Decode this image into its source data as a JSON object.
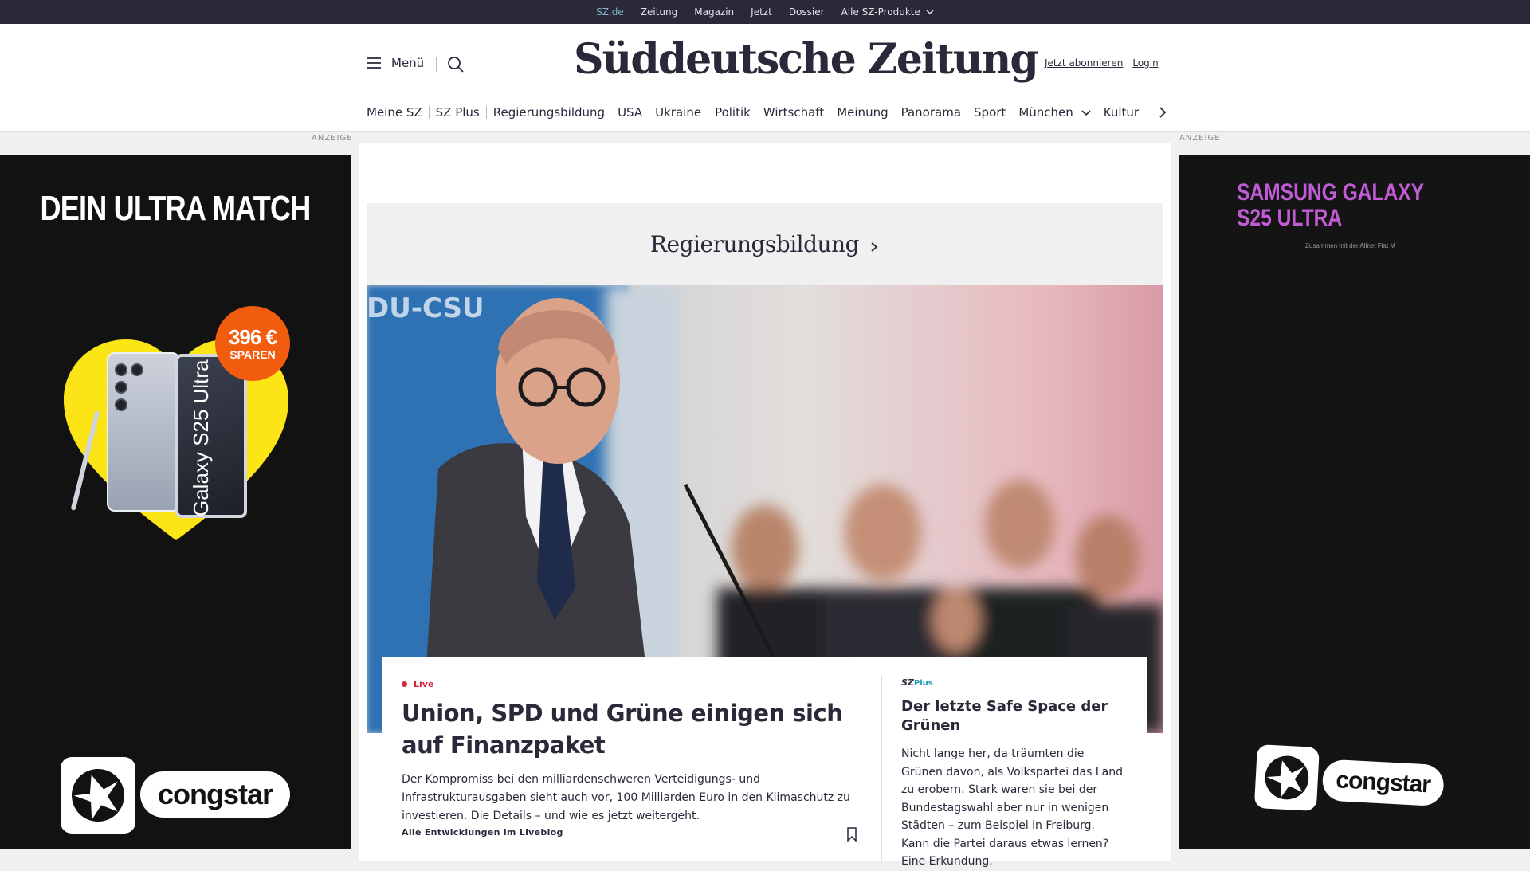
{
  "topbar": {
    "items": [
      {
        "label": "SZ.de",
        "active": true
      },
      {
        "label": "Zeitung"
      },
      {
        "label": "Magazin"
      },
      {
        "label": "Jetzt"
      },
      {
        "label": "Dossier"
      },
      {
        "label": "Alle SZ-Produkte",
        "has_dropdown": true
      }
    ]
  },
  "header": {
    "menu_label": "Menü",
    "search_icon": "search-icon",
    "logo_text": "Süddeutsche Zeitung",
    "subscribe_label": "Jetzt abonnieren",
    "login_label": "Login"
  },
  "nav": {
    "items": [
      {
        "label": "Meine SZ"
      },
      {
        "label": "SZ Plus"
      },
      {
        "label": "Regierungsbildung"
      },
      {
        "label": "USA"
      },
      {
        "label": "Ukraine"
      },
      {
        "label": "Politik"
      },
      {
        "label": "Wirtschaft"
      },
      {
        "label": "Meinung"
      },
      {
        "label": "Panorama"
      },
      {
        "label": "Sport"
      },
      {
        "label": "München",
        "has_dropdown": true
      },
      {
        "label": "Kultur"
      }
    ],
    "next_icon": "chevron-right-icon"
  },
  "ads": {
    "label": "ANZEIGE",
    "left": {
      "headline": "DEIN ULTRA MATCH",
      "badge_value": "396 €",
      "badge_text": "SPAREN",
      "phone_text": "Galaxy S25 Ultra",
      "brand": "congstar"
    },
    "right": {
      "headline_line1": "SAMSUNG GALAXY",
      "headline_line2": "S25 ULTRA",
      "small_text": "Zusammen mit der Allnet Flat M",
      "brand": "congstar"
    }
  },
  "teaser": {
    "section_title": "Regierungsbildung"
  },
  "lead_story": {
    "live_label": "Live",
    "headline": "Union, SPD und Grüne einigen sich auf Finanzpaket",
    "teaser": "Der Kompromiss bei den milliardenschweren Verteidigungs- und Infrastrukturausgaben sieht auch vor, 100 Milliarden Euro in den Klimaschutz zu investieren. Die Details – und wie es jetzt weitergeht.",
    "liveblog_link": "Alle Entwicklungen im Liveblog",
    "hero_sign_text": "DU-CSU"
  },
  "side_story": {
    "brand_sz": "SZ",
    "brand_plus": "Plus",
    "headline": "Der letzte Safe Space der Grünen",
    "teaser": "Nicht lange her, da träumten die Grünen davon, als Volkspartei das Land zu erobern. Stark waren sie bei der Bundestagswahl aber nur in wenigen Städten – zum Beispiel in Freiburg. Kann die Partei daraus etwas lernen? Eine Erkundung."
  },
  "colors": {
    "topbar_bg": "#29293a",
    "text": "#29293a",
    "live_red": "#d7263d",
    "plus_teal": "#1d9bb0",
    "ad_orange": "#f25c0f",
    "ad_yellow": "#fce516",
    "ad_purple": "#c25bd6"
  }
}
